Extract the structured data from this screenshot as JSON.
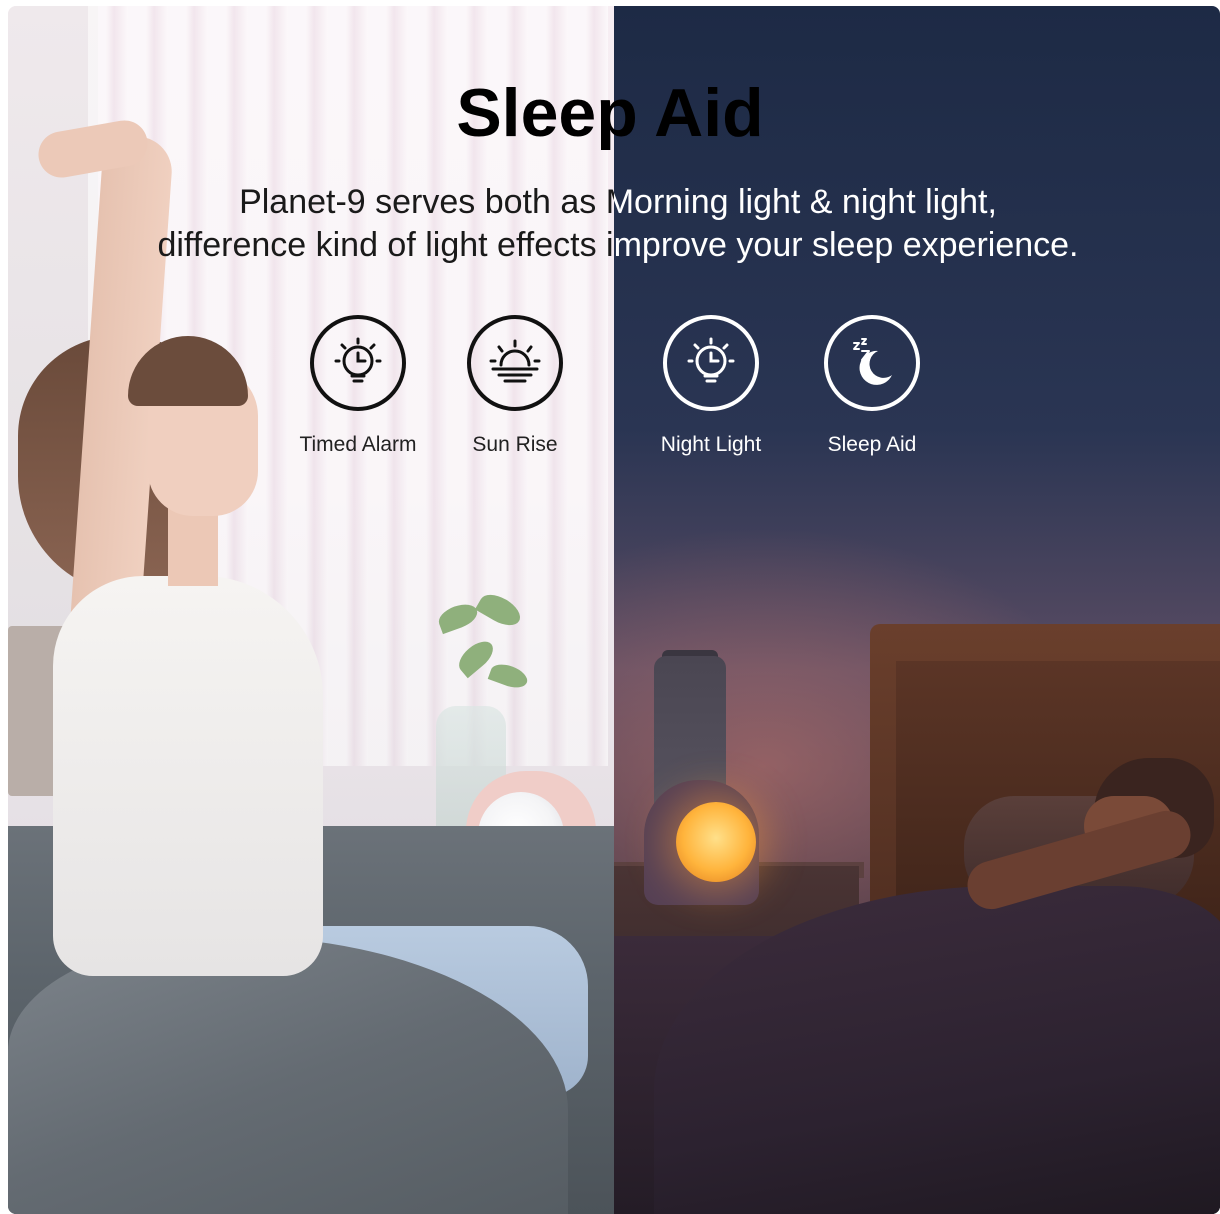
{
  "banner": {
    "title": "Sleep Aid",
    "description_line1": "Planet-9 serves both as Morning light & night light,",
    "description_line2": "difference kind of light effects improve your sleep experience."
  },
  "features": [
    {
      "label": "Timed Alarm",
      "icon": "timed-alarm-icon"
    },
    {
      "label": "Sun Rise",
      "icon": "sunrise-icon"
    },
    {
      "label": "Night Light",
      "icon": "night-light-icon"
    },
    {
      "label": "Sleep Aid",
      "icon": "sleep-moon-icon"
    }
  ],
  "colors": {
    "day_text": "#000000",
    "night_text": "#ffffff",
    "lamp_glow": "#ffb43c"
  }
}
